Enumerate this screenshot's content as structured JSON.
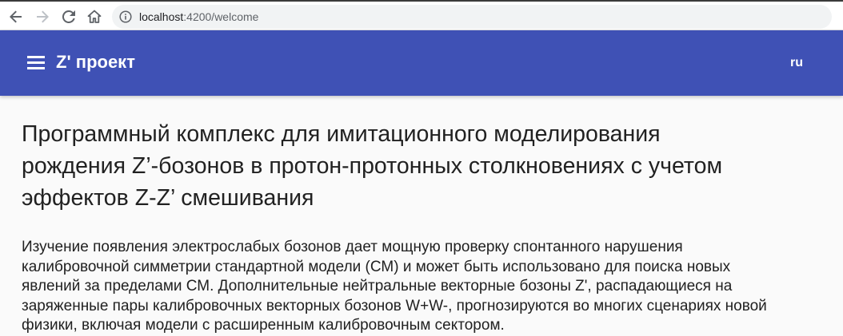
{
  "browser": {
    "url_host": "localhost",
    "url_rest": ":4200/welcome"
  },
  "header": {
    "title": "Z' проект",
    "language": "ru"
  },
  "main": {
    "heading_lines": [
      "Программный комплекс для имитационного моделирования",
      "рождения Z’-бозонов в протон-протонных столкновениях с учетом",
      "эффектов Z-Z’ смешивания"
    ],
    "paragraph_lines": [
      "Изучение появления электрослабых бозонов дает мощную проверку спонтанного нарушения",
      "калибровочной симметрии стандартной модели (СМ) и может быть использовано для поиска новых",
      "явлений за пределами СМ. Дополнительные нейтральные векторные бозоны Z', распадающиеся на",
      "заряженные пары калибровочных векторных бозонов W+W-, прогнозируются во многих сценариях новой",
      "физики, включая модели с расширенным калибровочным сектором."
    ]
  },
  "colors": {
    "primary": "#3f51b5",
    "background": "#fafafa",
    "text": "#212121"
  },
  "icons": [
    "back-arrow-icon",
    "forward-arrow-icon",
    "reload-icon",
    "home-icon",
    "info-icon",
    "menu-icon"
  ]
}
